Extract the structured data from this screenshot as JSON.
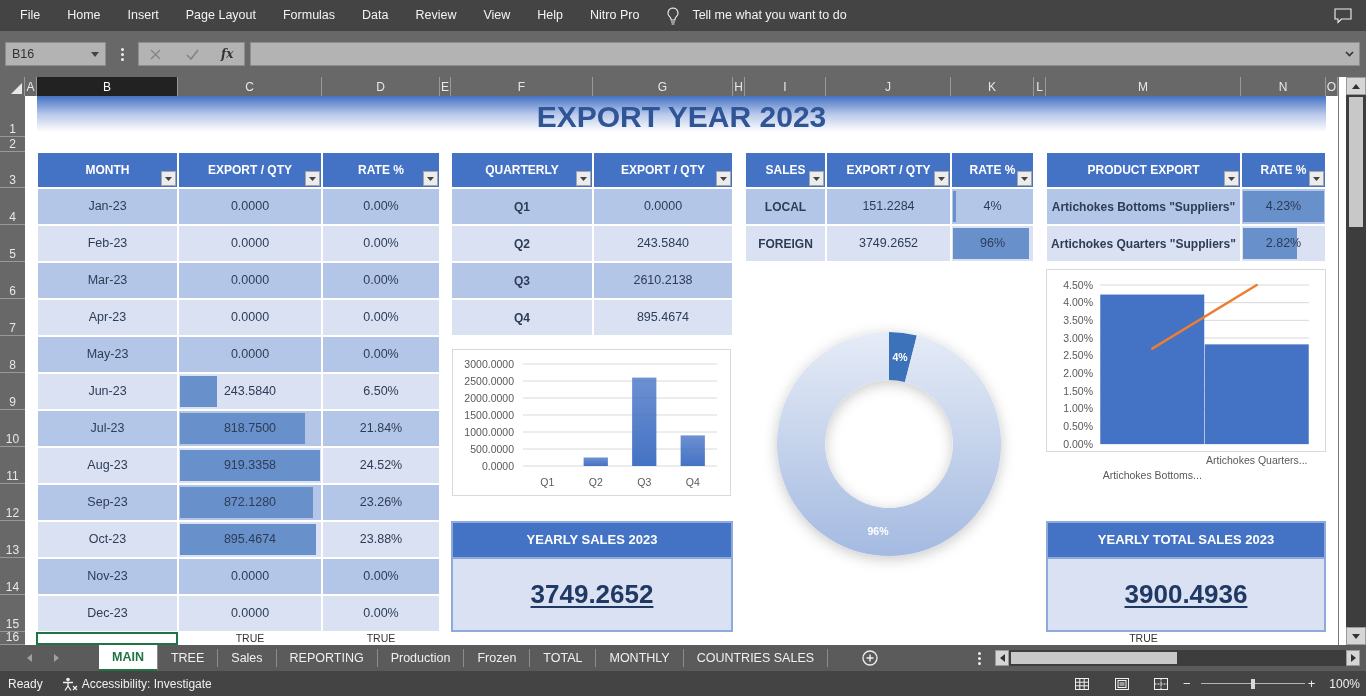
{
  "menu_bar": {
    "items": [
      "File",
      "Home",
      "Insert",
      "Page Layout",
      "Formulas",
      "Data",
      "Review",
      "View",
      "Help",
      "Nitro Pro"
    ],
    "search": {
      "placeholder": "Tell me what you want to do"
    }
  },
  "formula_bar": {
    "name_box": "B16",
    "function_button": "fx"
  },
  "columns": [
    {
      "label": "A",
      "selected": false
    },
    {
      "label": "B",
      "selected": true
    },
    {
      "label": "C",
      "selected": false
    },
    {
      "label": "D",
      "selected": false
    },
    {
      "label": "E",
      "selected": false
    },
    {
      "label": "F",
      "selected": false
    },
    {
      "label": "G",
      "selected": false
    },
    {
      "label": "H",
      "selected": false
    },
    {
      "label": "I",
      "selected": false
    },
    {
      "label": "J",
      "selected": false
    },
    {
      "label": "K",
      "selected": false
    },
    {
      "label": "L",
      "selected": false
    },
    {
      "label": "M",
      "selected": false
    },
    {
      "label": "N",
      "selected": false
    },
    {
      "label": "O",
      "selected": false
    }
  ],
  "rows": [
    "1",
    "2",
    "3",
    "4",
    "5",
    "6",
    "7",
    "8",
    "9",
    "10",
    "11",
    "12",
    "13",
    "14",
    "15",
    "16"
  ],
  "title": "EXPORT YEAR 2023",
  "monthly_table": {
    "columns": [
      "MONTH",
      "EXPORT / QTY",
      "RATE %"
    ],
    "rows": [
      {
        "month": "Jan-23",
        "export": "0.0000",
        "rate": "0.00%"
      },
      {
        "month": "Feb-23",
        "export": "0.0000",
        "rate": "0.00%"
      },
      {
        "month": "Mar-23",
        "export": "0.0000",
        "rate": "0.00%"
      },
      {
        "month": "Apr-23",
        "export": "0.0000",
        "rate": "0.00%"
      },
      {
        "month": "May-23",
        "export": "0.0000",
        "rate": "0.00%"
      },
      {
        "month": "Jun-23",
        "export": "243.5840",
        "level": 0.265,
        "rate": "6.50%"
      },
      {
        "month": "Jul-23",
        "export": "818.7500",
        "level": 0.891,
        "rate": "21.84%"
      },
      {
        "month": "Aug-23",
        "export": "919.3358",
        "level": 1,
        "rate": "24.52%"
      },
      {
        "month": "Sep-23",
        "export": "872.1280",
        "level": 0.949,
        "rate": "23.26%"
      },
      {
        "month": "Oct-23",
        "export": "895.4674",
        "level": 0.974,
        "rate": "23.88%"
      },
      {
        "month": "Nov-23",
        "export": "0.0000",
        "rate": "0.00%"
      },
      {
        "month": "Dec-23",
        "export": "0.0000",
        "rate": "0.00%"
      }
    ]
  },
  "quarterly_table": {
    "columns": [
      "QUARTERLY",
      "EXPORT / QTY"
    ],
    "rows": [
      {
        "quarter": "Q1",
        "export": "0.0000"
      },
      {
        "quarter": "Q2",
        "export": "243.5840"
      },
      {
        "quarter": "Q3",
        "export": "2610.2138"
      },
      {
        "quarter": "Q4",
        "export": "895.4674"
      }
    ]
  },
  "quarterly_chart": {
    "chart_data": {
      "type": "bar",
      "categories": [
        "Q1",
        "Q2",
        "Q3",
        "Q4"
      ],
      "series": [
        {
          "color": "#4472c4",
          "values": [
            0,
            250,
            2600,
            900
          ]
        }
      ],
      "ylim": [
        0,
        3000
      ],
      "yticks": [
        {
          "value": 0,
          "label": "0.0000"
        },
        {
          "value": 500,
          "label": "500.0000"
        },
        {
          "value": 1000,
          "label": "1000.0000"
        },
        {
          "value": 1500,
          "label": "1500.0000"
        },
        {
          "value": 2000,
          "label": "2000.0000"
        },
        {
          "value": 2500,
          "label": "2500.0000"
        },
        {
          "value": 3000,
          "label": "3000.0000"
        }
      ],
      "grid": true
    }
  },
  "yearly_sales": {
    "title": "YEARLY SALES 2023",
    "value": "3749.2652"
  },
  "sales_table": {
    "columns": [
      "SALES",
      "EXPORT / QTY",
      "RATE %"
    ],
    "rows": [
      {
        "sales": "LOCAL",
        "export": "151.2284",
        "rate": "4%",
        "level": 0.04
      },
      {
        "sales": "FOREIGN",
        "export": "3749.2652",
        "rate": "96%",
        "level": 0.96
      }
    ]
  },
  "sales_chart": {
    "chart_data": {
      "type": "donut",
      "values": [
        4,
        96
      ],
      "value_labels": [
        "4%",
        "96%"
      ]
    }
  },
  "product_table": {
    "columns": [
      "PRODUCT EXPORT",
      "RATE %"
    ],
    "rows": [
      {
        "product": "Artichokes Bottoms \"Suppliers\"",
        "rate": "4.23%",
        "level": 1
      },
      {
        "product": "Artichokes Quarters \"Suppliers\"",
        "rate": "2.82%",
        "level": 0.667
      }
    ]
  },
  "product_chart": {
    "chart_data": {
      "type": "bar",
      "categories": [
        "Artichokes Bottoms...",
        "Artichokes Quarters..."
      ],
      "series": [
        {
          "color": "#4472c4",
          "values": [
            4.23,
            2.82
          ]
        },
        {
          "type": "line",
          "color": "#ed7d31",
          "values": [
            2.7,
            4.5
          ]
        }
      ],
      "ylim": [
        0,
        4.5
      ],
      "yticks": [
        {
          "value": 0,
          "label": "0.00%"
        },
        {
          "value": 0.5,
          "label": "0.50%"
        },
        {
          "value": 1,
          "label": "1.00%"
        },
        {
          "value": 1.5,
          "label": "1.50%"
        },
        {
          "value": 2,
          "label": "2.00%"
        },
        {
          "value": 2.5,
          "label": "2.50%"
        },
        {
          "value": 3,
          "label": "3.00%"
        },
        {
          "value": 3.5,
          "label": "3.50%"
        },
        {
          "value": 4,
          "label": "4.00%"
        },
        {
          "value": 4.5,
          "label": "4.50%"
        }
      ],
      "grid": true
    }
  },
  "yearly_total_sales": {
    "title": "YEARLY TOTAL SALES 2023",
    "value": "3900.4936"
  },
  "row_16": [
    {
      "selected": true
    },
    {
      "text": "TRUE",
      "selected": false
    },
    {
      "text": "TRUE",
      "selected": false
    },
    {
      "text": "TRUE",
      "selected": false
    }
  ],
  "sheet_tabs": [
    {
      "label": "MAIN",
      "selected": true
    },
    {
      "label": "TREE",
      "selected": false
    },
    {
      "label": "Sales",
      "selected": false
    },
    {
      "label": "REPORTING",
      "selected": false
    },
    {
      "label": "Production",
      "selected": false
    },
    {
      "label": "Frozen",
      "selected": false
    },
    {
      "label": "TOTAL",
      "selected": false
    },
    {
      "label": "MONTHLY",
      "selected": false
    },
    {
      "label": "COUNTRIES SALES",
      "selected": false
    }
  ],
  "status_bar": {
    "status": "Ready",
    "accessibility": "Accessibility: Investigate",
    "zoom_out": "−",
    "zoom_slider": {
      "level": 0.5
    },
    "zoom_in": "+",
    "zoom": "100%"
  }
}
